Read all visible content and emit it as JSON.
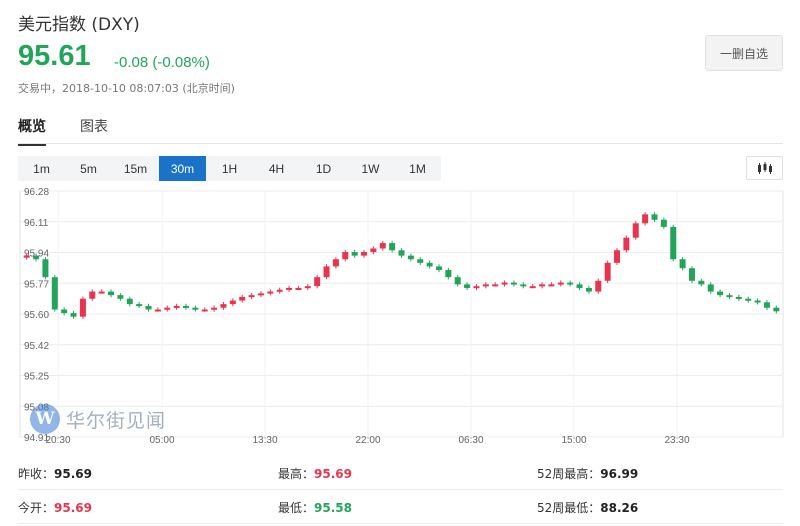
{
  "header": {
    "title": "美元指数 (DXY)",
    "price": "95.61",
    "change": "-0.08 (-0.08%)",
    "status": "交易中，2018-10-10 08:07:03 (北京时间)",
    "watchlist_button": "一删自选"
  },
  "tabs": [
    {
      "label": "概览",
      "active": true
    },
    {
      "label": "图表",
      "active": false
    }
  ],
  "periods": [
    {
      "label": "1m",
      "active": false
    },
    {
      "label": "5m",
      "active": false
    },
    {
      "label": "15m",
      "active": false
    },
    {
      "label": "30m",
      "active": true
    },
    {
      "label": "1H",
      "active": false
    },
    {
      "label": "4H",
      "active": false
    },
    {
      "label": "1D",
      "active": false
    },
    {
      "label": "1W",
      "active": false
    },
    {
      "label": "1M",
      "active": false
    }
  ],
  "chart_icon": "candlestick-icon",
  "watermark": {
    "logo": "W",
    "text": "华尔街见闻"
  },
  "colors": {
    "up": "#e8344e",
    "down": "#22a55a",
    "accent": "#1a73c8"
  },
  "chart_data": {
    "type": "candlestick",
    "yticks": [
      "96.28",
      "96.11",
      "95.94",
      "95.77",
      "95.60",
      "95.42",
      "95.25",
      "95.08",
      "94.91"
    ],
    "ylim": [
      94.91,
      96.28
    ],
    "xticks": [
      "20:30",
      "05:00",
      "13:30",
      "22:00",
      "06:30",
      "15:00",
      "23:30"
    ],
    "grid": true,
    "close_series": [
      95.92,
      95.9,
      95.8,
      95.62,
      95.6,
      95.58,
      95.68,
      95.72,
      95.72,
      95.7,
      95.68,
      95.65,
      95.64,
      95.62,
      95.62,
      95.63,
      95.64,
      95.63,
      95.62,
      95.62,
      95.63,
      95.65,
      95.67,
      95.69,
      95.7,
      95.71,
      95.72,
      95.73,
      95.74,
      95.74,
      95.75,
      95.8,
      95.86,
      95.9,
      95.94,
      95.92,
      95.94,
      95.96,
      95.99,
      95.95,
      95.92,
      95.9,
      95.88,
      95.86,
      95.84,
      95.8,
      95.76,
      95.74,
      95.75,
      95.76,
      95.76,
      95.77,
      95.76,
      95.75,
      95.75,
      95.76,
      95.76,
      95.77,
      95.76,
      95.74,
      95.72,
      95.78,
      95.88,
      95.95,
      96.02,
      96.1,
      96.15,
      96.12,
      96.08,
      95.9,
      95.85,
      95.78,
      95.76,
      95.72,
      95.7,
      95.69,
      95.68,
      95.67,
      95.66,
      95.63,
      95.61
    ]
  },
  "stats": [
    [
      {
        "label": "昨收：",
        "value": "95.69",
        "color": "dark"
      },
      {
        "label": "最高：",
        "value": "95.69",
        "color": "red"
      },
      {
        "label": "52周最高：",
        "value": "96.99",
        "color": "dark"
      }
    ],
    [
      {
        "label": "今开：",
        "value": "95.69",
        "color": "red"
      },
      {
        "label": "最低：",
        "value": "95.58",
        "color": "green"
      },
      {
        "label": "52周最低：",
        "value": "88.26",
        "color": "dark"
      }
    ]
  ]
}
